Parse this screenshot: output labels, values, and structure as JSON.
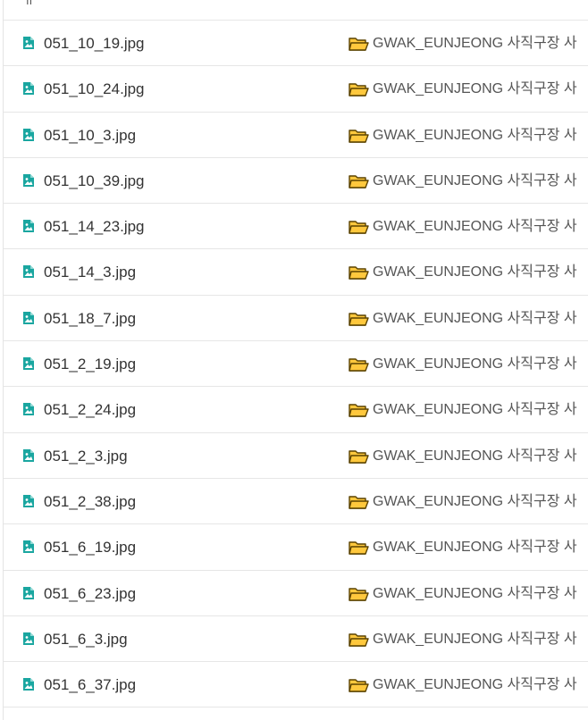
{
  "files": [
    {
      "name": "051_10_19.jpg",
      "location": "GWAK_EUNJEONG 사직구장 사"
    },
    {
      "name": "051_10_24.jpg",
      "location": "GWAK_EUNJEONG 사직구장 사"
    },
    {
      "name": "051_10_3.jpg",
      "location": "GWAK_EUNJEONG 사직구장 사"
    },
    {
      "name": "051_10_39.jpg",
      "location": "GWAK_EUNJEONG 사직구장 사"
    },
    {
      "name": "051_14_23.jpg",
      "location": "GWAK_EUNJEONG 사직구장 사"
    },
    {
      "name": "051_14_3.jpg",
      "location": "GWAK_EUNJEONG 사직구장 사"
    },
    {
      "name": "051_18_7.jpg",
      "location": "GWAK_EUNJEONG 사직구장 사"
    },
    {
      "name": "051_2_19.jpg",
      "location": "GWAK_EUNJEONG 사직구장 사"
    },
    {
      "name": "051_2_24.jpg",
      "location": "GWAK_EUNJEONG 사직구장 사"
    },
    {
      "name": "051_2_3.jpg",
      "location": "GWAK_EUNJEONG 사직구장 사"
    },
    {
      "name": "051_2_38.jpg",
      "location": "GWAK_EUNJEONG 사직구장 사"
    },
    {
      "name": "051_6_19.jpg",
      "location": "GWAK_EUNJEONG 사직구장 사"
    },
    {
      "name": "051_6_23.jpg",
      "location": "GWAK_EUNJEONG 사직구장 사"
    },
    {
      "name": "051_6_3.jpg",
      "location": "GWAK_EUNJEONG 사직구장 사"
    },
    {
      "name": "051_6_37.jpg",
      "location": "GWAK_EUNJEONG 사직구장 사"
    }
  ],
  "icons": {
    "file": "image-file-icon",
    "folder": "folder-icon"
  },
  "colors": {
    "file_icon": "#1aa6a0",
    "folder_fill": "#ffc83d",
    "folder_stroke": "#5a4200",
    "text": "#333333",
    "divider": "#e6e6e6"
  }
}
